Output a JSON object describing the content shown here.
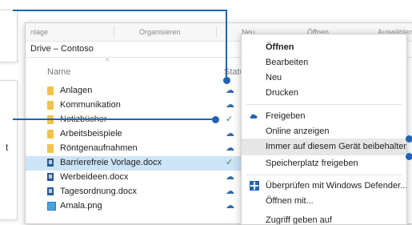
{
  "left_panel": {
    "partial_text": "t"
  },
  "explorer": {
    "ribbon": {
      "items": [
        "nlage",
        "Organisieren",
        "Neu",
        "Öffnen",
        "Auswählen"
      ]
    },
    "path": "Drive – Contoso",
    "columns": {
      "name": "Name",
      "status": "Statu"
    },
    "files": [
      {
        "name": "Anlagen",
        "type": "folder",
        "status": "cloud"
      },
      {
        "name": "Kommunikation",
        "type": "folder",
        "status": "cloud"
      },
      {
        "name": "Notizbücher",
        "type": "folder",
        "status": "synced"
      },
      {
        "name": "Arbeitsbeispiele",
        "type": "folder",
        "status": "cloud"
      },
      {
        "name": "Röntgenaufnahmen",
        "type": "folder",
        "status": "cloud"
      },
      {
        "name": "Barrierefreie Vorlage.docx",
        "type": "docx",
        "status": "synced",
        "selected": true
      },
      {
        "name": "Werbeideen.docx",
        "type": "docx",
        "status": "cloud"
      },
      {
        "name": "Tagesordnung.docx",
        "type": "docx",
        "status": "cloud"
      },
      {
        "name": "Amala.png",
        "type": "png",
        "status": "cloud"
      }
    ]
  },
  "context_menu": {
    "items": [
      {
        "label": "Öffnen",
        "bold": true
      },
      {
        "label": "Bearbeiten"
      },
      {
        "label": "Neu"
      },
      {
        "label": "Drucken"
      },
      {
        "label": "Freigeben",
        "icon": "onedrive-cloud-icon"
      },
      {
        "label": "Online anzeigen"
      },
      {
        "label": "Immer auf diesem Gerät beibehalten",
        "highlighted": true
      },
      {
        "label": "Speicherplatz freigeben"
      },
      {
        "label": "Überprüfen mit Windows Defender...",
        "icon": "defender-shield-icon"
      },
      {
        "label": "Öffnen mit..."
      },
      {
        "label": "Zugriff geben auf"
      }
    ]
  },
  "colors": {
    "accent": "#1f64b5",
    "selection": "#cce4f7",
    "highlight": "#e6e6e6",
    "synced": "#2e8b3d"
  }
}
